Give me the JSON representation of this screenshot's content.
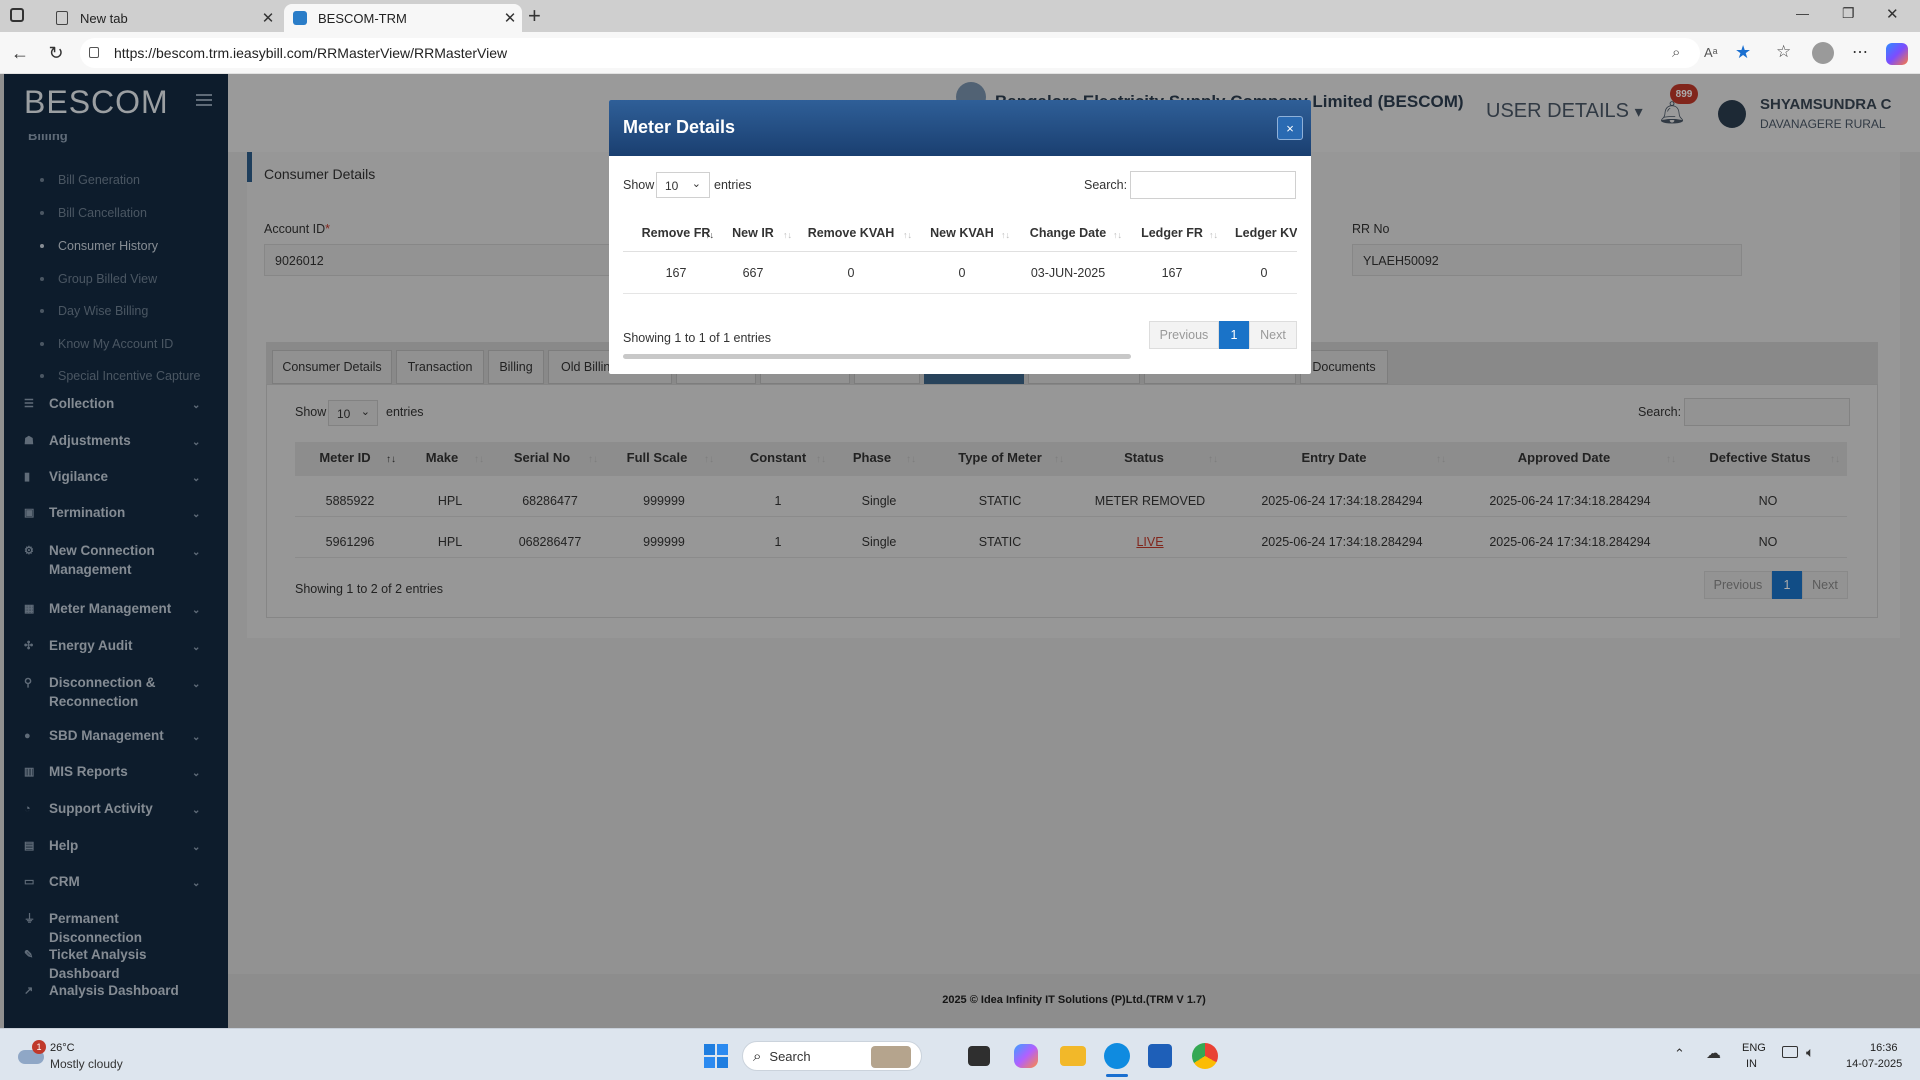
{
  "browser": {
    "tabs": [
      {
        "title": "New tab",
        "active": false
      },
      {
        "title": "BESCOM-TRM",
        "active": true
      }
    ],
    "url": "https://bescom.trm.ieasybill.com/RRMasterView/RRMasterView",
    "new_tab_symbol": "+",
    "window_controls": {
      "minimize": "—",
      "restore": "❐",
      "close": "✕"
    }
  },
  "sidebar": {
    "logo": "BESCOM",
    "partial_item": "Billing",
    "sub_items": [
      {
        "label": "Bill Generation",
        "current": false
      },
      {
        "label": "Bill Cancellation",
        "current": false
      },
      {
        "label": "Consumer History",
        "current": true
      },
      {
        "label": "Group Billed View",
        "current": false
      },
      {
        "label": "Day Wise Billing",
        "current": false
      },
      {
        "label": "Know My Account ID",
        "current": false
      },
      {
        "label": "Special Incentive Capture",
        "current": false
      }
    ],
    "menu_items": [
      {
        "label": "Collection",
        "icon": "list-icon",
        "glyph": "☰",
        "chevron": true
      },
      {
        "label": "Adjustments",
        "icon": "users-icon",
        "glyph": "☗",
        "chevron": true
      },
      {
        "label": "Vigilance",
        "icon": "chart-icon",
        "glyph": "▮",
        "chevron": true
      },
      {
        "label": "Termination",
        "icon": "box-icon",
        "glyph": "▣",
        "chevron": true
      },
      {
        "label": "New Connection Management",
        "icon": "gear-icon",
        "glyph": "⚙",
        "chevron": true
      },
      {
        "label": "Meter Management",
        "icon": "grid-icon",
        "glyph": "▦",
        "chevron": true
      },
      {
        "label": "Energy Audit",
        "icon": "network-icon",
        "glyph": "✣",
        "chevron": true
      },
      {
        "label": "Disconnection & Reconnection",
        "icon": "link-icon",
        "glyph": "⚲",
        "chevron": true
      },
      {
        "label": "SBD Management",
        "icon": "circle-icon",
        "glyph": "●",
        "chevron": true
      },
      {
        "label": "MIS Reports",
        "icon": "bar-chart-icon",
        "glyph": "▥",
        "chevron": true
      },
      {
        "label": "Support Activity",
        "icon": "gauge-icon",
        "glyph": "◔",
        "chevron": true
      },
      {
        "label": "Help",
        "icon": "book-icon",
        "glyph": "▤",
        "chevron": true
      },
      {
        "label": "CRM",
        "icon": "monitor-icon",
        "glyph": "▭",
        "chevron": true
      },
      {
        "label": "Permanent Disconnection",
        "icon": "plug-icon",
        "glyph": "⏚",
        "chevron": false
      },
      {
        "label": "Ticket Analysis Dashboard",
        "icon": "pen-icon",
        "glyph": "✎",
        "chevron": false
      },
      {
        "label": "Analysis Dashboard",
        "icon": "line-chart-icon",
        "glyph": "↗",
        "chevron": false
      }
    ],
    "chevron_glyph": "⌄"
  },
  "header": {
    "org_title": "Bangalore Electricity Supply Company Limited (BESCOM)",
    "user_details": "USER DETAILS",
    "notifications": "899",
    "user_name": "SHYAMSUNDRA C",
    "user_location": "DAVANAGERE RURAL"
  },
  "consumer": {
    "panel_title": "Consumer Details",
    "account_label": "Account ID",
    "required_mark": "*",
    "account_value": "9026012",
    "rr_label": "RR No",
    "rr_value": "YLAEH50092",
    "tabs": [
      "Consumer Details",
      "Transaction",
      "Billing",
      "Old Billin",
      "",
      "",
      "",
      "",
      "",
      "",
      "Documents"
    ],
    "show_label": "Show",
    "show_value": "10",
    "entries_label": "entries",
    "search_label": "Search:",
    "columns": [
      "Meter ID",
      "Make",
      "Serial No",
      "Full Scale",
      "Constant",
      "Phase",
      "Type of Meter",
      "Status",
      "Entry Date",
      "Approved Date",
      "Defective Status"
    ],
    "rows": [
      [
        "5885922",
        "HPL",
        "68286477",
        "999999",
        "1",
        "Single",
        "STATIC",
        "METER REMOVED",
        "2025-06-24 17:34:18.284294",
        "2025-06-24 17:34:18.284294",
        "NO"
      ],
      [
        "5961296",
        "HPL",
        "068286477",
        "999999",
        "1",
        "Single",
        "STATIC",
        "LIVE",
        "2025-06-24 17:34:18.284294",
        "2025-06-24 17:34:18.284294",
        "NO"
      ]
    ],
    "showing": "Showing 1 to 2 of 2 entries",
    "prev": "Previous",
    "page": "1",
    "next": "Next"
  },
  "footer": "2025 © Idea Infinity IT Solutions (P)Ltd.(TRM V 1.7)",
  "modal": {
    "title": "Meter Details",
    "close": "×",
    "show_label": "Show",
    "show_value": "10",
    "entries_label": "entries",
    "search_label": "Search:",
    "columns": [
      "Remove FR",
      "New IR",
      "Remove KVAH",
      "New KVAH",
      "Change Date",
      "Ledger FR",
      "Ledger KV."
    ],
    "row": [
      "167",
      "667",
      "0",
      "0",
      "03-JUN-2025",
      "167",
      "0"
    ],
    "showing": "Showing 1 to 1 of 1 entries",
    "prev": "Previous",
    "page": "1",
    "next": "Next"
  },
  "taskbar": {
    "weather_temp": "26°C",
    "weather_desc": "Mostly cloudy",
    "weather_badge": "1",
    "search": "Search",
    "lang1": "ENG",
    "lang2": "IN",
    "time": "16:36",
    "date": "14-07-2025"
  },
  "colors": {
    "sidebar_bg": "#142a42",
    "modal_header": "#1f4a80",
    "accent_blue": "#1a73c8",
    "live_red": "#c0392b"
  }
}
